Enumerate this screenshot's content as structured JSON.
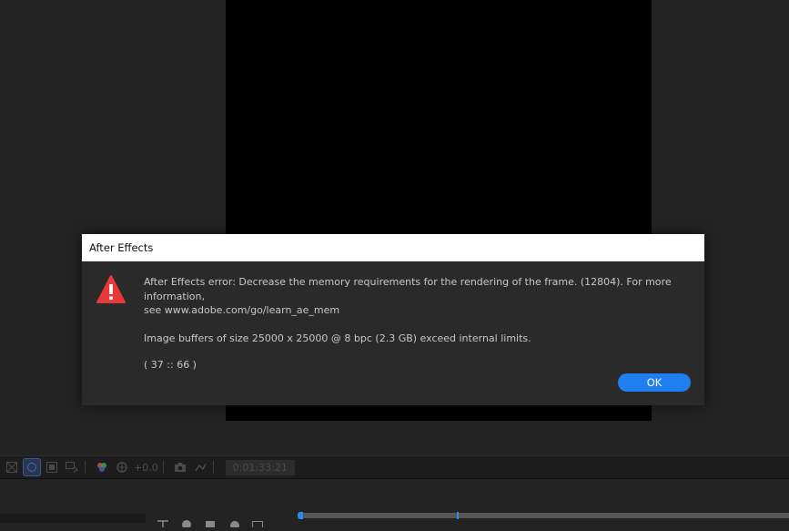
{
  "dialog": {
    "title": "After Effects",
    "alert_icon": "warning-triangle-icon",
    "message_line1": "After Effects error: Decrease the memory requirements for the rendering of the frame. (12804). For more information,",
    "message_line2": "see www.adobe.com/go/learn_ae_mem",
    "message_limits": "Image buffers of size 25000 x 25000 @ 8 bpc (2.3 GB) exceed internal limits.",
    "message_code": "( 37 :: 66 )",
    "ok_label": "OK"
  },
  "viewer_toolbar": {
    "exposure_value": "+0.0",
    "timecode": "0:01:33:21",
    "icons": [
      "transparency-grid-icon",
      "mask-icon",
      "region-icon",
      "3d-view-icon",
      "color-channels-icon",
      "exposure-icon",
      "camera-snapshot-icon",
      "show-snapshot-icon"
    ]
  },
  "colors": {
    "accent": "#1f7ef0",
    "alert": "#e8383a",
    "panel_bg": "#232323",
    "dialog_bg": "#2a2a2a"
  }
}
